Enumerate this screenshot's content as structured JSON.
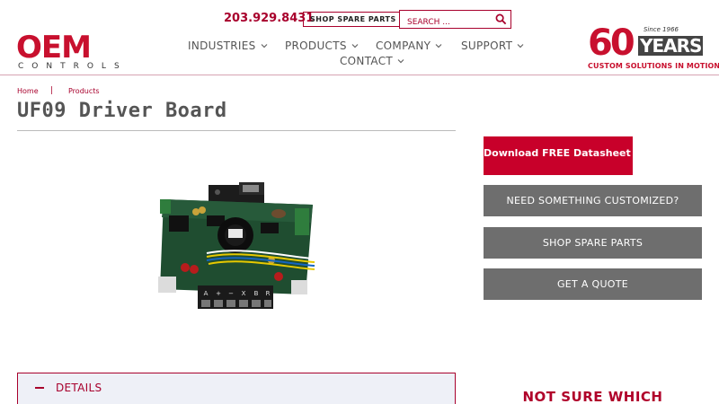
{
  "header": {
    "logo_main": "OEM",
    "logo_sub": "CONTROLS",
    "phone": "203.929.8431",
    "shop_label": "SHOP SPARE PARTS",
    "search_placeholder": "SEARCH ...",
    "nav": [
      {
        "label": "INDUSTRIES"
      },
      {
        "label": "PRODUCTS"
      },
      {
        "label": "COMPANY"
      },
      {
        "label": "SUPPORT"
      },
      {
        "label": "CONTACT"
      }
    ],
    "badge": {
      "since": "Since 1966",
      "number": "60",
      "years": "YEARS",
      "tagline": "CUSTOM SOLUTIONS IN MOTION"
    }
  },
  "breadcrumb": {
    "home": "Home",
    "separator": "|",
    "products": "Products"
  },
  "page": {
    "title": "UF09 Driver Board"
  },
  "details": {
    "label": "DETAILS"
  },
  "sidebar": {
    "download": "Download FREE Datasheet",
    "customized": "NEED SOMETHING CUSTOMIZED?",
    "shop_parts": "SHOP SPARE PARTS",
    "quote": "GET A QUOTE",
    "not_sure": "NOT SURE WHICH"
  },
  "product_image": {
    "terminal_labels": [
      "A",
      "+",
      "−",
      "X",
      "B",
      "R"
    ]
  },
  "colors": {
    "brand_red": "#c8102e",
    "link_red": "#a8002c",
    "button_gray": "#6e6e6e",
    "details_bg": "#eef0f7"
  }
}
